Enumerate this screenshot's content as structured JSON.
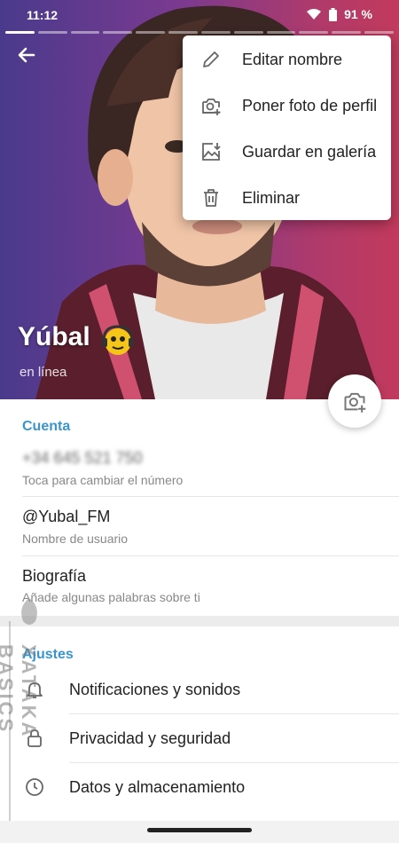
{
  "status_bar": {
    "time": "11:12",
    "battery": "91 %"
  },
  "profile": {
    "name": "Yúbal",
    "status": "en línea"
  },
  "menu": {
    "items": [
      {
        "label": "Editar nombre",
        "icon": "pencil-icon"
      },
      {
        "label": "Poner foto de perfil",
        "icon": "camera-add-icon"
      },
      {
        "label": "Guardar en galería",
        "icon": "image-download-icon"
      },
      {
        "label": "Eliminar",
        "icon": "trash-icon"
      }
    ]
  },
  "account": {
    "header": "Cuenta",
    "phone": {
      "value": "+34 645 521 750",
      "sub": "Toca para cambiar el número"
    },
    "username": {
      "value": "@Yubal_FM",
      "sub": "Nombre de usuario"
    },
    "bio": {
      "value": "Biografía",
      "sub": "Añade algunas palabras sobre ti"
    }
  },
  "settings": {
    "header": "Ajustes",
    "items": [
      {
        "label": "Notificaciones y sonidos",
        "icon": "bell-icon"
      },
      {
        "label": "Privacidad y seguridad",
        "icon": "lock-icon"
      },
      {
        "label": "Datos y almacenamiento",
        "icon": "clock-icon"
      }
    ]
  },
  "watermark": {
    "text": "XATAKA BASICS"
  },
  "colors": {
    "accent": "#3a95cf",
    "hero_left": "#4a3a8c",
    "hero_right": "#c23a5c"
  }
}
